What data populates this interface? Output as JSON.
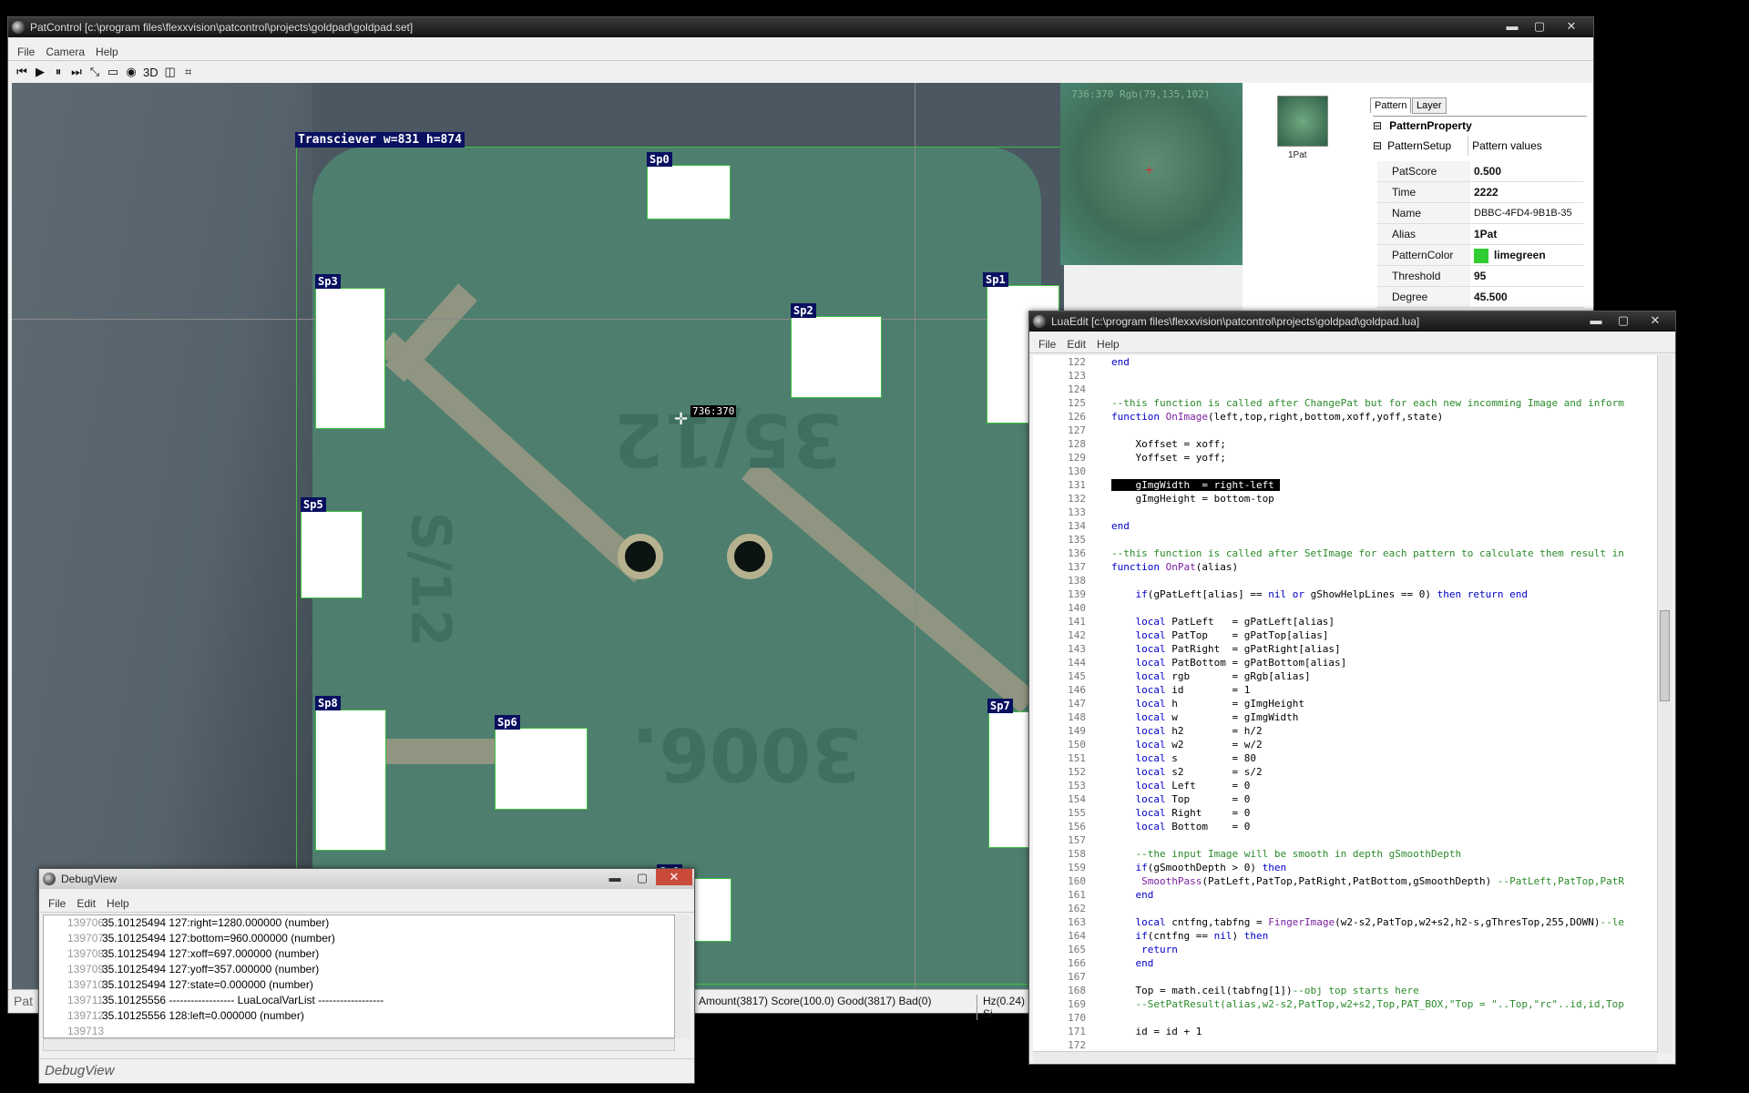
{
  "main_window": {
    "title": "PatControl [c:\\program files\\flexxvision\\patcontrol\\projects\\goldpad\\goldpad.set]",
    "menu": [
      "File",
      "Camera",
      "Help"
    ],
    "toolbar": [
      "⏮",
      "▶",
      "⏸",
      "⏭",
      "⤡",
      "▭",
      "◉",
      "3D",
      "◫",
      "⌗"
    ]
  },
  "camera_view": {
    "roi_label": "Transciever w=831 h=874",
    "cursor_readout": "736:370",
    "spots": [
      "Sp0",
      "Sp1",
      "Sp2",
      "Sp3",
      "Sp5",
      "Sp6",
      "Sp7",
      "Sp8",
      "Sp9"
    ],
    "etched_text": [
      "35/12",
      "3006.",
      "S/12"
    ]
  },
  "preview": {
    "overlay_line1": "736:370  Rgb(79,135,102)",
    "thumb_label": "1Pat"
  },
  "property_panel": {
    "tabs": [
      "Pattern",
      "Layer"
    ],
    "header": "PatternProperty",
    "group": "PatternSetup",
    "group_value": "Pattern values",
    "rows": [
      {
        "k": "PatScore",
        "v": "0.500"
      },
      {
        "k": "Time",
        "v": "2222"
      },
      {
        "k": "Name",
        "v": "DBBC-4FD4-9B1B-35"
      },
      {
        "k": "Alias",
        "v": "1Pat"
      },
      {
        "k": "PatternColor",
        "v": "limegreen"
      },
      {
        "k": "Threshold",
        "v": "95"
      },
      {
        "k": "Degree",
        "v": "45.500"
      }
    ]
  },
  "status": {
    "left": "Pat",
    "mid": "Amount(3817) Score(100.0) Good(3817) Bad(0)",
    "right": "Hz(0.24) Si"
  },
  "lua_edit": {
    "title": "LuaEdit [c:\\program files\\flexxvision\\patcontrol\\projects\\goldpad\\goldpad.lua]",
    "menu": [
      "File",
      "Edit",
      "Help"
    ],
    "lines": [
      {
        "n": "122",
        "t": "end"
      },
      {
        "n": "123",
        "t": ""
      },
      {
        "n": "124",
        "t": ""
      },
      {
        "n": "125",
        "t": "--this function is called after ChangePat but for each new incomming Image and inform"
      },
      {
        "n": "126",
        "t": "function OnImage(left,top,right,bottom,xoff,yoff,state)"
      },
      {
        "n": "127",
        "t": ""
      },
      {
        "n": "128",
        "t": "    Xoffset = xoff;"
      },
      {
        "n": "129",
        "t": "    Yoffset = yoff;"
      },
      {
        "n": "130",
        "t": ""
      },
      {
        "n": "131",
        "t": "    gImgWidth  = right-left "
      },
      {
        "n": "132",
        "t": "    gImgHeight = bottom-top"
      },
      {
        "n": "133",
        "t": ""
      },
      {
        "n": "134",
        "t": "end"
      },
      {
        "n": "135",
        "t": ""
      },
      {
        "n": "136",
        "t": "--this function is called after SetImage for each pattern to calculate them result in"
      },
      {
        "n": "137",
        "t": "function OnPat(alias)"
      },
      {
        "n": "138",
        "t": ""
      },
      {
        "n": "139",
        "t": "    if(gPatLeft[alias] == nil or gShowHelpLines == 0) then return end"
      },
      {
        "n": "140",
        "t": ""
      },
      {
        "n": "141",
        "t": "    local PatLeft   = gPatLeft[alias]"
      },
      {
        "n": "142",
        "t": "    local PatTop    = gPatTop[alias]"
      },
      {
        "n": "143",
        "t": "    local PatRight  = gPatRight[alias]"
      },
      {
        "n": "144",
        "t": "    local PatBottom = gPatBottom[alias]"
      },
      {
        "n": "145",
        "t": "    local rgb       = gRgb[alias]"
      },
      {
        "n": "146",
        "t": "    local id        = 1"
      },
      {
        "n": "147",
        "t": "    local h         = gImgHeight"
      },
      {
        "n": "148",
        "t": "    local w         = gImgWidth"
      },
      {
        "n": "149",
        "t": "    local h2        = h/2"
      },
      {
        "n": "150",
        "t": "    local w2        = w/2"
      },
      {
        "n": "151",
        "t": "    local s         = 80"
      },
      {
        "n": "152",
        "t": "    local s2        = s/2"
      },
      {
        "n": "153",
        "t": "    local Left      = 0"
      },
      {
        "n": "154",
        "t": "    local Top       = 0"
      },
      {
        "n": "155",
        "t": "    local Right     = 0"
      },
      {
        "n": "156",
        "t": "    local Bottom    = 0"
      },
      {
        "n": "157",
        "t": ""
      },
      {
        "n": "158",
        "t": "    --the input Image will be smooth in depth gSmoothDepth"
      },
      {
        "n": "159",
        "t": "    if(gSmoothDepth > 0) then"
      },
      {
        "n": "160",
        "t": "     SmoothPass(PatLeft,PatTop,PatRight,PatBottom,gSmoothDepth) --PatLeft,PatTop,PatR"
      },
      {
        "n": "161",
        "t": "    end"
      },
      {
        "n": "162",
        "t": ""
      },
      {
        "n": "163",
        "t": "    local cntfng,tabfng = FingerImage(w2-s2,PatTop,w2+s2,h2-s,gThresTop,255,DOWN)--le"
      },
      {
        "n": "164",
        "t": "    if(cntfng == nil) then"
      },
      {
        "n": "165",
        "t": "     return"
      },
      {
        "n": "166",
        "t": "    end"
      },
      {
        "n": "167",
        "t": ""
      },
      {
        "n": "168",
        "t": "    Top = math.ceil(tabfng[1])--obj top starts here"
      },
      {
        "n": "169",
        "t": "    --SetPatResult(alias,w2-s2,PatTop,w2+s2,Top,PAT_BOX,\"Top = \"..Top,\"rc\"..id,id,Top"
      },
      {
        "n": "170",
        "t": ""
      },
      {
        "n": "171",
        "t": "    id = id + 1"
      },
      {
        "n": "172",
        "t": ""
      }
    ]
  },
  "debug_view": {
    "title": "DebugView",
    "menu": [
      "File",
      "Edit",
      "Help"
    ],
    "lines": [
      {
        "n": "139706",
        "t": "35.10125494 127:right=1280.000000 (number)"
      },
      {
        "n": "139707",
        "t": "35.10125494 127:bottom=960.000000 (number)"
      },
      {
        "n": "139708",
        "t": "35.10125494 127:xoff=697.000000 (number)"
      },
      {
        "n": "139709",
        "t": "35.10125494 127:yoff=357.000000 (number)"
      },
      {
        "n": "139710",
        "t": "35.10125494 127:state=0.000000 (number)"
      },
      {
        "n": "139711",
        "t": "35.10125556 ------------------ LuaLocalVarList ------------------"
      },
      {
        "n": "139712",
        "t": "35.10125556 128:left=0.000000 (number)"
      },
      {
        "n": "139713",
        "t": ""
      }
    ],
    "status": "DebugView"
  },
  "colors": {
    "pattern_color": "#32cd32",
    "selection_bg": "#000000"
  }
}
